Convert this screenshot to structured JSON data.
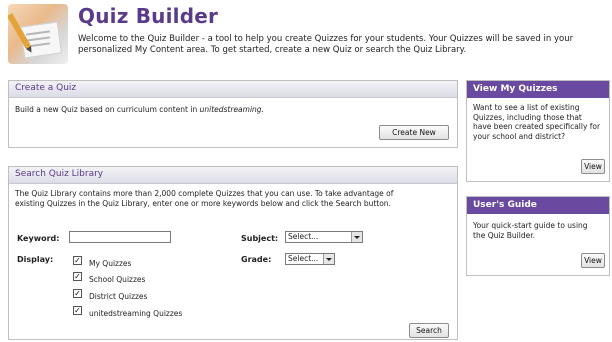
{
  "header": {
    "title": "Quiz Builder",
    "intro_line1": "Welcome to the Quiz Builder - a tool to help you create Quizzes for your students. Your Quizzes will be saved in your",
    "intro_line2": "personalized My Content area. To get started, create a new Quiz or search the Quiz Library.",
    "logo_icon": "quiz-pencil-icon"
  },
  "create": {
    "title": "Create a Quiz",
    "desc_prefix": "Build a new Quiz based on curriculum content in ",
    "desc_em": "unitedstreaming.",
    "button": "Create New"
  },
  "search": {
    "title": "Search Quiz Library",
    "desc_line1": "The Quiz Library contains more than 2,000 complete Quizzes that you can use. To take advantage of",
    "desc_line2": "existing Quizzes in the Quiz Library, enter one or more keywords below and click the Search button.",
    "keyword_label": "Keyword:",
    "keyword_value": "",
    "display_label": "Display:",
    "display_options": [
      "My Quizzes",
      "School Quizzes",
      "District Quizzes",
      "unitedstreaming Quizzes"
    ],
    "subject_label": "Subject:",
    "subject_value": "Select...",
    "grade_label": "Grade:",
    "grade_value": "Select...",
    "button": "Search"
  },
  "view_quizzes": {
    "title": "View My Quizzes",
    "lines": [
      "Want to see a list of existing",
      "Quizzes, including those that",
      "have been created specifically for",
      "your school and district?"
    ],
    "button": "View"
  },
  "guide": {
    "title": "User's Guide",
    "lines": [
      "Your quick-start guide to using",
      "the Quiz Builder."
    ],
    "button": "View"
  },
  "colors": {
    "accent": "#5a3a8a",
    "side_header": "#6a4aa0"
  }
}
